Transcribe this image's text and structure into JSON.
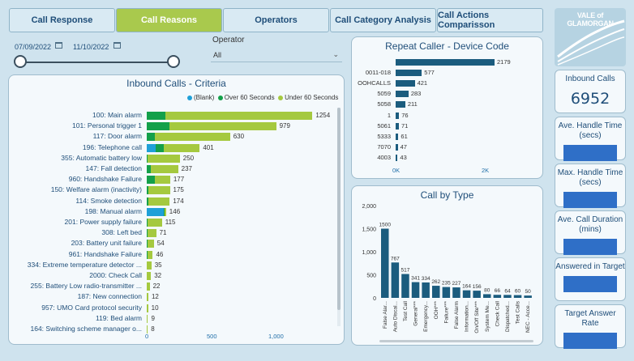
{
  "tabs": [
    {
      "label": "Call Response",
      "active": false
    },
    {
      "label": "Call Reasons",
      "active": true
    },
    {
      "label": "Operators",
      "active": false
    },
    {
      "label": "Call Category Analysis",
      "active": false
    },
    {
      "label": "Call Actions Comparisson",
      "active": false
    }
  ],
  "filters": {
    "start_date": "07/09/2022",
    "end_date": "11/10/2022",
    "operator_label": "Operator",
    "operator_value": "All"
  },
  "logo_text": "VALE of GLAMORGAN",
  "inbound_criteria": {
    "title": "Inbound Calls - Criteria",
    "legend": [
      "(Blank)",
      "Over 60 Seconds",
      "Under 60 Seconds"
    ],
    "colors": {
      "blank": "#1fa0d8",
      "over": "#14a04a",
      "under": "#a5c93f"
    },
    "axis_ticks": [
      "0",
      "500",
      "1,000"
    ],
    "rows": [
      {
        "label": "100: Main alarm",
        "blank": 0,
        "over": 140,
        "under": 1114,
        "total": "1254"
      },
      {
        "label": "101: Personal trigger 1",
        "blank": 0,
        "over": 170,
        "under": 809,
        "total": "979"
      },
      {
        "label": "117: Door alarm",
        "blank": 0,
        "over": 60,
        "under": 570,
        "total": "630"
      },
      {
        "label": "196: Telephone call",
        "blank": 70,
        "over": 60,
        "under": 271,
        "total": "401"
      },
      {
        "label": "355: Automatic battery low",
        "blank": 0,
        "over": 5,
        "under": 245,
        "total": "250"
      },
      {
        "label": "147: Fall detection",
        "blank": 0,
        "over": 30,
        "under": 207,
        "total": "237"
      },
      {
        "label": "960: Handshake Failure",
        "blank": 0,
        "over": 60,
        "under": 117,
        "total": "177"
      },
      {
        "label": "150: Welfare alarm (inactivity)",
        "blank": 0,
        "over": 10,
        "under": 165,
        "total": "175"
      },
      {
        "label": "114: Smoke detection",
        "blank": 0,
        "over": 15,
        "under": 159,
        "total": "174"
      },
      {
        "label": "198: Manual alarm",
        "blank": 130,
        "over": 5,
        "under": 11,
        "total": "146"
      },
      {
        "label": "201: Power supply failure",
        "blank": 0,
        "over": 5,
        "under": 110,
        "total": "115"
      },
      {
        "label": "308: Left bed",
        "blank": 0,
        "over": 5,
        "under": 66,
        "total": "71"
      },
      {
        "label": "203: Battery unit failure",
        "blank": 0,
        "over": 5,
        "under": 49,
        "total": "54"
      },
      {
        "label": "961: Handshake Failure",
        "blank": 0,
        "over": 8,
        "under": 38,
        "total": "46"
      },
      {
        "label": "334: Extreme temperature detector ...",
        "blank": 0,
        "over": 3,
        "under": 32,
        "total": "35"
      },
      {
        "label": "2000: Check Call",
        "blank": 0,
        "over": 3,
        "under": 29,
        "total": "32"
      },
      {
        "label": "255: Battery Low radio-transmitter ...",
        "blank": 0,
        "over": 3,
        "under": 19,
        "total": "22"
      },
      {
        "label": "187: New connection",
        "blank": 0,
        "over": 2,
        "under": 10,
        "total": "12"
      },
      {
        "label": "957: UMO Card protocol security",
        "blank": 0,
        "over": 2,
        "under": 8,
        "total": "10"
      },
      {
        "label": "119: Bed alarm",
        "blank": 0,
        "over": 1,
        "under": 8,
        "total": "9"
      },
      {
        "label": "164: Switching scheme manager o...",
        "blank": 0,
        "over": 1,
        "under": 7,
        "total": "8"
      }
    ]
  },
  "repeat_caller": {
    "title": "Repeat Caller - Device Code",
    "color": "#1b5c7e",
    "axis_ticks": [
      "0K",
      "2K"
    ],
    "rows": [
      {
        "label": "",
        "value": 2179,
        "text": "2179"
      },
      {
        "label": "0011-018",
        "value": 577,
        "text": "577"
      },
      {
        "label": "OOHCALLS",
        "value": 421,
        "text": "421"
      },
      {
        "label": "5059",
        "value": 283,
        "text": "283"
      },
      {
        "label": "5058",
        "value": 211,
        "text": "211"
      },
      {
        "label": "1",
        "value": 76,
        "text": "76"
      },
      {
        "label": "5061",
        "value": 71,
        "text": "71"
      },
      {
        "label": "5333",
        "value": 61,
        "text": "61"
      },
      {
        "label": "7070",
        "value": 47,
        "text": "47"
      },
      {
        "label": "4003",
        "value": 43,
        "text": "43"
      }
    ]
  },
  "call_by_type": {
    "title": "Call by Type",
    "color": "#1b5c7e",
    "y_ticks": [
      "0",
      "500",
      "1,000",
      "1,500",
      "2,000"
    ],
    "bars": [
      {
        "label": "False Alar...",
        "value": 1500,
        "text": "1500"
      },
      {
        "label": "Auto Discal...",
        "value": 767,
        "text": "767"
      },
      {
        "label": "Test Call",
        "value": 517,
        "text": "517"
      },
      {
        "label": "General***",
        "value": 341,
        "text": "341"
      },
      {
        "label": "Emergency...",
        "value": 334,
        "text": "334"
      },
      {
        "label": "OOH***",
        "value": 262,
        "text": "262"
      },
      {
        "label": "Failure***",
        "value": 235,
        "text": "235"
      },
      {
        "label": "False Alarm",
        "value": 227,
        "text": "227"
      },
      {
        "label": "Information...",
        "value": 164,
        "text": "164"
      },
      {
        "label": "On/Off Site***",
        "value": 156,
        "text": "156"
      },
      {
        "label": "System Me...",
        "value": 80,
        "text": "80"
      },
      {
        "label": "Check Call",
        "value": 66,
        "text": "66"
      },
      {
        "label": "Dispatched...",
        "value": 64,
        "text": "64"
      },
      {
        "label": "Test Calls",
        "value": 60,
        "text": "60"
      },
      {
        "label": "NEC - Acce...",
        "value": 50,
        "text": "50"
      }
    ]
  },
  "kpis": {
    "inbound_calls_label": "Inbound Calls",
    "inbound_calls_value": "6952",
    "handle_time_label": "Ave. Handle Time (secs)",
    "max_handle_label": "Max. Handle Time (secs)",
    "call_duration_label": "Ave. Call Duration (mins)",
    "answered_label": "Answered in Target",
    "target_rate_label": "Target Answer Rate",
    "placeholder_color": "#2f6fc7"
  }
}
